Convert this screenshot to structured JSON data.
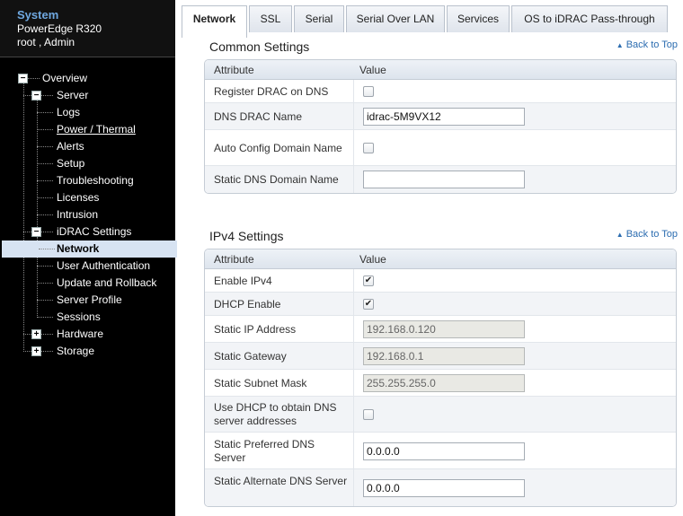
{
  "system": {
    "title": "System",
    "model": "PowerEdge R320",
    "user": "root , Admin"
  },
  "tree": [
    {
      "label": "Overview",
      "toggle": "−"
    },
    {
      "label": "Server",
      "toggle": "−"
    },
    {
      "label": "Logs"
    },
    {
      "label": "Power / Thermal",
      "underline": true
    },
    {
      "label": "Alerts"
    },
    {
      "label": "Setup"
    },
    {
      "label": "Troubleshooting"
    },
    {
      "label": "Licenses"
    },
    {
      "label": "Intrusion"
    },
    {
      "label": "iDRAC Settings",
      "toggle": "−"
    },
    {
      "label": "Network",
      "selected": true
    },
    {
      "label": "User Authentication"
    },
    {
      "label": "Update and Rollback"
    },
    {
      "label": "Server Profile"
    },
    {
      "label": "Sessions"
    },
    {
      "label": "Hardware",
      "toggle": "+"
    },
    {
      "label": "Storage",
      "toggle": "+"
    }
  ],
  "tabs": [
    "Network",
    "SSL",
    "Serial",
    "Serial Over LAN",
    "Services",
    "OS to iDRAC Pass-through"
  ],
  "active_tab": "Network",
  "back_to_top": "Back to Top",
  "common": {
    "title": "Common Settings",
    "col_attr": "Attribute",
    "col_value": "Value",
    "rows": [
      {
        "label": "Register DRAC on DNS",
        "type": "checkbox",
        "checked": false
      },
      {
        "label": "DNS DRAC Name",
        "type": "text",
        "value": "idrac-5M9VX12"
      },
      {
        "label": "Auto Config Domain Name",
        "type": "checkbox",
        "checked": false
      },
      {
        "label": "Static DNS Domain Name",
        "type": "text",
        "value": ""
      }
    ]
  },
  "ipv4": {
    "title": "IPv4 Settings",
    "col_attr": "Attribute",
    "col_value": "Value",
    "rows": [
      {
        "label": "Enable IPv4",
        "type": "checkbox",
        "checked": true
      },
      {
        "label": "DHCP Enable",
        "type": "checkbox",
        "checked": true
      },
      {
        "label": "Static IP Address",
        "type": "text",
        "value": "192.168.0.120",
        "disabled": true
      },
      {
        "label": "Static Gateway",
        "type": "text",
        "value": "192.168.0.1",
        "disabled": true
      },
      {
        "label": "Static Subnet Mask",
        "type": "text",
        "value": "255.255.255.0",
        "disabled": true
      },
      {
        "label": "Use DHCP to obtain DNS server addresses",
        "type": "checkbox",
        "checked": false
      },
      {
        "label": "Static Preferred DNS Server",
        "type": "text",
        "value": "0.0.0.0"
      },
      {
        "label": "Static Alternate DNS Server",
        "type": "text",
        "value": "0.0.0.0"
      }
    ]
  }
}
